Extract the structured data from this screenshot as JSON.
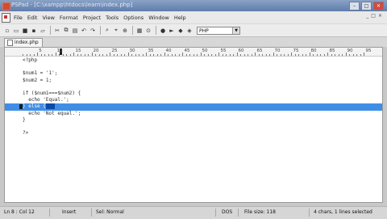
{
  "window": {
    "title": "PSPad - [C:\\xampp\\htdocs\\learn\\index.php]",
    "min": "–",
    "max": "□",
    "close": "✕"
  },
  "menu": {
    "items": [
      "File",
      "Edit",
      "View",
      "Format",
      "Project",
      "Tools",
      "Options",
      "Window",
      "Help"
    ],
    "mdi_controls": [
      "_",
      "□",
      "×"
    ]
  },
  "toolbar": {
    "language": "PHP"
  },
  "tabs": [
    {
      "label": "index.php",
      "active": true
    }
  ],
  "ruler": {
    "numbers": [
      "5",
      "10",
      "15",
      "20",
      "25",
      "30",
      "35",
      "40",
      "45",
      "50",
      "55",
      "60",
      "65",
      "70",
      "75",
      "80",
      "85",
      "90",
      "95"
    ]
  },
  "code": [
    {
      "text": "<?php"
    },
    {
      "text": ""
    },
    {
      "text": "$num1 = '1';"
    },
    {
      "text": "$num2 = 1;"
    },
    {
      "text": ""
    },
    {
      "text": "if ($num1===$num2) {"
    },
    {
      "text": "  echo 'Equal.';"
    },
    {
      "text": "} else {",
      "highlight": true,
      "selected_text": "   "
    },
    {
      "text": "  echo 'Not equal.';"
    },
    {
      "text": "}"
    },
    {
      "text": ""
    },
    {
      "text": "?>"
    }
  ],
  "status": {
    "position": "Ln 8 : Col 12",
    "mode": "Insert",
    "syntax": "Sel: Normal",
    "line_end": "DOS",
    "file_size": "File size: 118",
    "selection": "4 chars, 1 lines selected"
  },
  "colors": {
    "title_bar": "#6f8ab5",
    "line_highlight": "#3f8ee6",
    "selection": "#0d49a8"
  }
}
